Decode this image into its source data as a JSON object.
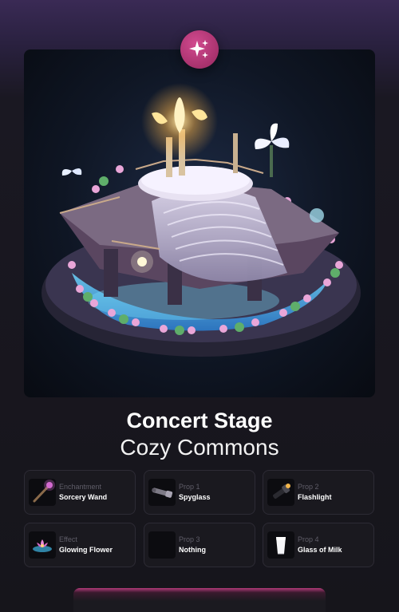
{
  "badge": {
    "icon": "sparkles-icon",
    "color": "#a8326d"
  },
  "header": {
    "title": "Concert Stage",
    "subtitle": "Cozy Commons"
  },
  "items": [
    {
      "key": "Enchantment",
      "value": "Sorcery Wand",
      "icon": "wand-icon"
    },
    {
      "key": "Prop 1",
      "value": "Spyglass",
      "icon": "spyglass-icon"
    },
    {
      "key": "Prop 2",
      "value": "Flashlight",
      "icon": "flashlight-icon"
    },
    {
      "key": "Effect",
      "value": "Glowing Flower",
      "icon": "flower-icon"
    },
    {
      "key": "Prop 3",
      "value": "Nothing",
      "icon": "empty-icon"
    },
    {
      "key": "Prop 4",
      "value": "Glass of Milk",
      "icon": "milk-glass-icon"
    }
  ]
}
